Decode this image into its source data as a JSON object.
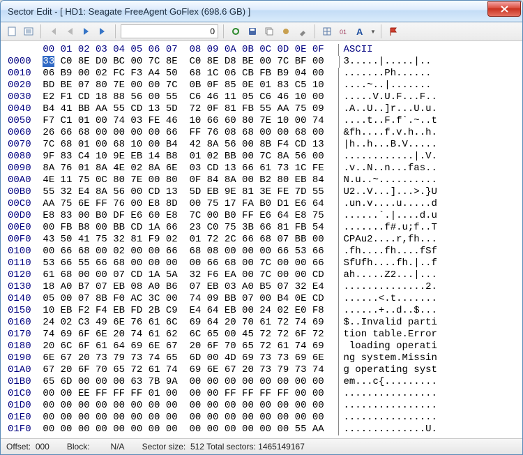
{
  "title": "Sector Edit - [ HD1: Seagate FreeAgent GoFlex (698.6 GB) ]",
  "toolbar": {
    "offset_value": "0"
  },
  "hex_header_cols": [
    "00",
    "01",
    "02",
    "03",
    "04",
    "05",
    "06",
    "07",
    "08",
    "09",
    "0A",
    "0B",
    "0C",
    "0D",
    "0E",
    "0F"
  ],
  "ascii_header": "ASCII",
  "selected": {
    "row": 0,
    "col": 0
  },
  "rows": [
    {
      "o": "0000",
      "h": [
        "33",
        "C0",
        "8E",
        "D0",
        "BC",
        "00",
        "7C",
        "8E",
        "C0",
        "8E",
        "D8",
        "BE",
        "00",
        "7C",
        "BF",
        "00"
      ],
      "a": "3.....|.....|.."
    },
    {
      "o": "0010",
      "h": [
        "06",
        "B9",
        "00",
        "02",
        "FC",
        "F3",
        "A4",
        "50",
        "68",
        "1C",
        "06",
        "CB",
        "FB",
        "B9",
        "04",
        "00"
      ],
      "a": ".......Ph......"
    },
    {
      "o": "0020",
      "h": [
        "BD",
        "BE",
        "07",
        "80",
        "7E",
        "00",
        "00",
        "7C",
        "0B",
        "0F",
        "85",
        "0E",
        "01",
        "83",
        "C5",
        "10"
      ],
      "a": "....~..|......."
    },
    {
      "o": "0030",
      "h": [
        "E2",
        "F1",
        "CD",
        "18",
        "88",
        "56",
        "00",
        "55",
        "C6",
        "46",
        "11",
        "05",
        "C6",
        "46",
        "10",
        "00"
      ],
      "a": ".....V.U.F...F.."
    },
    {
      "o": "0040",
      "h": [
        "B4",
        "41",
        "BB",
        "AA",
        "55",
        "CD",
        "13",
        "5D",
        "72",
        "0F",
        "81",
        "FB",
        "55",
        "AA",
        "75",
        "09"
      ],
      "a": ".A..U..]r...U.u."
    },
    {
      "o": "0050",
      "h": [
        "F7",
        "C1",
        "01",
        "00",
        "74",
        "03",
        "FE",
        "46",
        "10",
        "66",
        "60",
        "80",
        "7E",
        "10",
        "00",
        "74"
      ],
      "a": "....t..F.f`.~..t"
    },
    {
      "o": "0060",
      "h": [
        "26",
        "66",
        "68",
        "00",
        "00",
        "00",
        "00",
        "66",
        "FF",
        "76",
        "08",
        "68",
        "00",
        "00",
        "68",
        "00"
      ],
      "a": "&fh....f.v.h..h."
    },
    {
      "o": "0070",
      "h": [
        "7C",
        "68",
        "01",
        "00",
        "68",
        "10",
        "00",
        "B4",
        "42",
        "8A",
        "56",
        "00",
        "8B",
        "F4",
        "CD",
        "13"
      ],
      "a": "|h..h...B.V....."
    },
    {
      "o": "0080",
      "h": [
        "9F",
        "83",
        "C4",
        "10",
        "9E",
        "EB",
        "14",
        "B8",
        "01",
        "02",
        "BB",
        "00",
        "7C",
        "8A",
        "56",
        "00"
      ],
      "a": "............|.V."
    },
    {
      "o": "0090",
      "h": [
        "8A",
        "76",
        "01",
        "8A",
        "4E",
        "02",
        "8A",
        "6E",
        "03",
        "CD",
        "13",
        "66",
        "61",
        "73",
        "1C",
        "FE"
      ],
      "a": ".v..N..n...fas.."
    },
    {
      "o": "00A0",
      "h": [
        "4E",
        "11",
        "75",
        "0C",
        "80",
        "7E",
        "00",
        "80",
        "0F",
        "84",
        "8A",
        "00",
        "B2",
        "80",
        "EB",
        "84"
      ],
      "a": "N.u..~.........."
    },
    {
      "o": "00B0",
      "h": [
        "55",
        "32",
        "E4",
        "8A",
        "56",
        "00",
        "CD",
        "13",
        "5D",
        "EB",
        "9E",
        "81",
        "3E",
        "FE",
        "7D",
        "55"
      ],
      "a": "U2..V...]...>.}U"
    },
    {
      "o": "00C0",
      "h": [
        "AA",
        "75",
        "6E",
        "FF",
        "76",
        "00",
        "E8",
        "8D",
        "00",
        "75",
        "17",
        "FA",
        "B0",
        "D1",
        "E6",
        "64"
      ],
      "a": ".un.v....u.....d"
    },
    {
      "o": "00D0",
      "h": [
        "E8",
        "83",
        "00",
        "B0",
        "DF",
        "E6",
        "60",
        "E8",
        "7C",
        "00",
        "B0",
        "FF",
        "E6",
        "64",
        "E8",
        "75"
      ],
      "a": "......`.|....d.u"
    },
    {
      "o": "00E0",
      "h": [
        "00",
        "FB",
        "B8",
        "00",
        "BB",
        "CD",
        "1A",
        "66",
        "23",
        "C0",
        "75",
        "3B",
        "66",
        "81",
        "FB",
        "54"
      ],
      "a": ".......f#.u;f..T"
    },
    {
      "o": "00F0",
      "h": [
        "43",
        "50",
        "41",
        "75",
        "32",
        "81",
        "F9",
        "02",
        "01",
        "72",
        "2C",
        "66",
        "68",
        "07",
        "BB",
        "00"
      ],
      "a": "CPAu2....r,fh..."
    },
    {
      "o": "0100",
      "h": [
        "00",
        "66",
        "68",
        "00",
        "02",
        "00",
        "00",
        "66",
        "68",
        "08",
        "00",
        "00",
        "00",
        "66",
        "53",
        "66"
      ],
      "a": ".fh....fh....fSf"
    },
    {
      "o": "0110",
      "h": [
        "53",
        "66",
        "55",
        "66",
        "68",
        "00",
        "00",
        "00",
        "00",
        "66",
        "68",
        "00",
        "7C",
        "00",
        "00",
        "66"
      ],
      "a": "SfUfh....fh.|..f"
    },
    {
      "o": "0120",
      "h": [
        "61",
        "68",
        "00",
        "00",
        "07",
        "CD",
        "1A",
        "5A",
        "32",
        "F6",
        "EA",
        "00",
        "7C",
        "00",
        "00",
        "CD"
      ],
      "a": "ah.....Z2...|..."
    },
    {
      "o": "0130",
      "h": [
        "18",
        "A0",
        "B7",
        "07",
        "EB",
        "08",
        "A0",
        "B6",
        "07",
        "EB",
        "03",
        "A0",
        "B5",
        "07",
        "32",
        "E4"
      ],
      "a": "..............2."
    },
    {
      "o": "0140",
      "h": [
        "05",
        "00",
        "07",
        "8B",
        "F0",
        "AC",
        "3C",
        "00",
        "74",
        "09",
        "BB",
        "07",
        "00",
        "B4",
        "0E",
        "CD"
      ],
      "a": "......<.t......."
    },
    {
      "o": "0150",
      "h": [
        "10",
        "EB",
        "F2",
        "F4",
        "EB",
        "FD",
        "2B",
        "C9",
        "E4",
        "64",
        "EB",
        "00",
        "24",
        "02",
        "E0",
        "F8"
      ],
      "a": "......+..d..$..."
    },
    {
      "o": "0160",
      "h": [
        "24",
        "02",
        "C3",
        "49",
        "6E",
        "76",
        "61",
        "6C",
        "69",
        "64",
        "20",
        "70",
        "61",
        "72",
        "74",
        "69"
      ],
      "a": "$..Invalid parti"
    },
    {
      "o": "0170",
      "h": [
        "74",
        "69",
        "6F",
        "6E",
        "20",
        "74",
        "61",
        "62",
        "6C",
        "65",
        "00",
        "45",
        "72",
        "72",
        "6F",
        "72"
      ],
      "a": "tion table.Error"
    },
    {
      "o": "0180",
      "h": [
        "20",
        "6C",
        "6F",
        "61",
        "64",
        "69",
        "6E",
        "67",
        "20",
        "6F",
        "70",
        "65",
        "72",
        "61",
        "74",
        "69"
      ],
      "a": " loading operati"
    },
    {
      "o": "0190",
      "h": [
        "6E",
        "67",
        "20",
        "73",
        "79",
        "73",
        "74",
        "65",
        "6D",
        "00",
        "4D",
        "69",
        "73",
        "73",
        "69",
        "6E"
      ],
      "a": "ng system.Missin"
    },
    {
      "o": "01A0",
      "h": [
        "67",
        "20",
        "6F",
        "70",
        "65",
        "72",
        "61",
        "74",
        "69",
        "6E",
        "67",
        "20",
        "73",
        "79",
        "73",
        "74"
      ],
      "a": "g operating syst"
    },
    {
      "o": "01B0",
      "h": [
        "65",
        "6D",
        "00",
        "00",
        "00",
        "63",
        "7B",
        "9A",
        "00",
        "00",
        "00",
        "00",
        "00",
        "00",
        "00",
        "00"
      ],
      "a": "em...c{........."
    },
    {
      "o": "01C0",
      "h": [
        "00",
        "00",
        "EE",
        "FF",
        "FF",
        "FF",
        "01",
        "00",
        "00",
        "00",
        "FF",
        "FF",
        "FF",
        "FF",
        "00",
        "00"
      ],
      "a": "................"
    },
    {
      "o": "01D0",
      "h": [
        "00",
        "00",
        "00",
        "00",
        "00",
        "00",
        "00",
        "00",
        "00",
        "00",
        "00",
        "00",
        "00",
        "00",
        "00",
        "00"
      ],
      "a": "................"
    },
    {
      "o": "01E0",
      "h": [
        "00",
        "00",
        "00",
        "00",
        "00",
        "00",
        "00",
        "00",
        "00",
        "00",
        "00",
        "00",
        "00",
        "00",
        "00",
        "00"
      ],
      "a": "................"
    },
    {
      "o": "01F0",
      "h": [
        "00",
        "00",
        "00",
        "00",
        "00",
        "00",
        "00",
        "00",
        "00",
        "00",
        "00",
        "00",
        "00",
        "00",
        "55",
        "AA"
      ],
      "a": "..............U."
    }
  ],
  "status": {
    "offset_label": "Offset:",
    "offset_value": "000",
    "block_label": "Block:",
    "block_value": "N/A",
    "sector_size_label": "Sector size:",
    "sector_size_value": "512",
    "total_sectors_label": "Total sectors:",
    "total_sectors_value": "1465149167"
  }
}
